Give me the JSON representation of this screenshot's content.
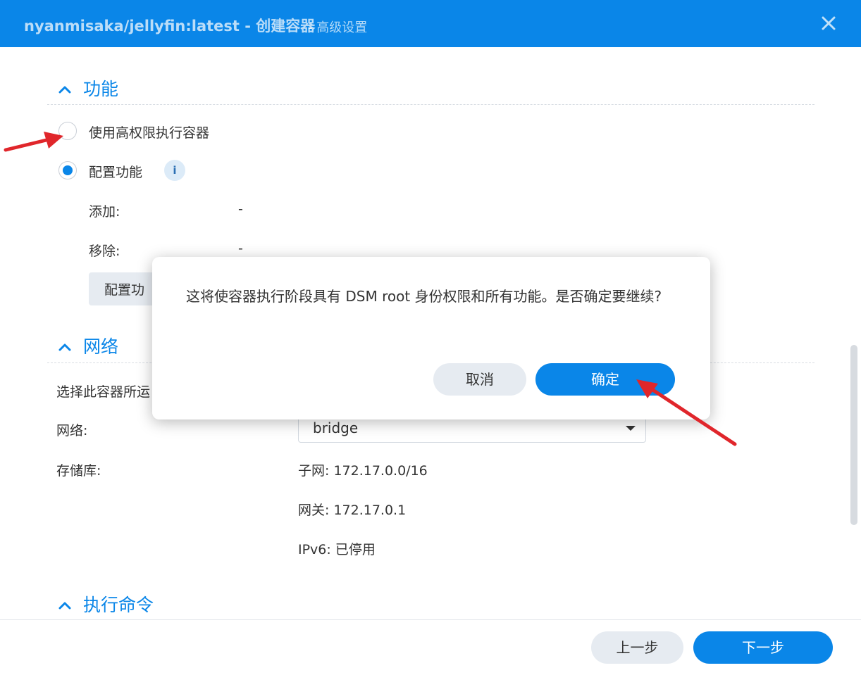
{
  "window": {
    "title": "nyanmisaka/jellyfin:latest - 创建容器",
    "subtitle": "- 高级设置"
  },
  "sections": {
    "capabilities": {
      "title": "功能",
      "option_privileged": "使用高权限执行容器",
      "option_configure": "配置功能",
      "selected_option": "option_configure",
      "add_label": "添加:",
      "add_value": "-",
      "remove_label": "移除:",
      "remove_value": "-",
      "configure_button": "配置功"
    },
    "network": {
      "title": "网络",
      "description": "选择此容器所运",
      "network_label": "网络:",
      "network_value": "bridge",
      "storage_label": "存储库:",
      "subnet": "子网: 172.17.0.0/16",
      "gateway": "网关: 172.17.0.1",
      "ipv6": "IPv6: 已停用"
    },
    "command": {
      "title": "执行命令"
    }
  },
  "modal": {
    "message": "这将使容器执行阶段具有 DSM root 身份权限和所有功能。是否确定要继续?",
    "cancel_label": "取消",
    "confirm_label": "确定"
  },
  "footer": {
    "prev_label": "上一步",
    "next_label": "下一步"
  },
  "colors": {
    "accent": "#0a86e8",
    "annotation_arrow": "#e0262b"
  }
}
